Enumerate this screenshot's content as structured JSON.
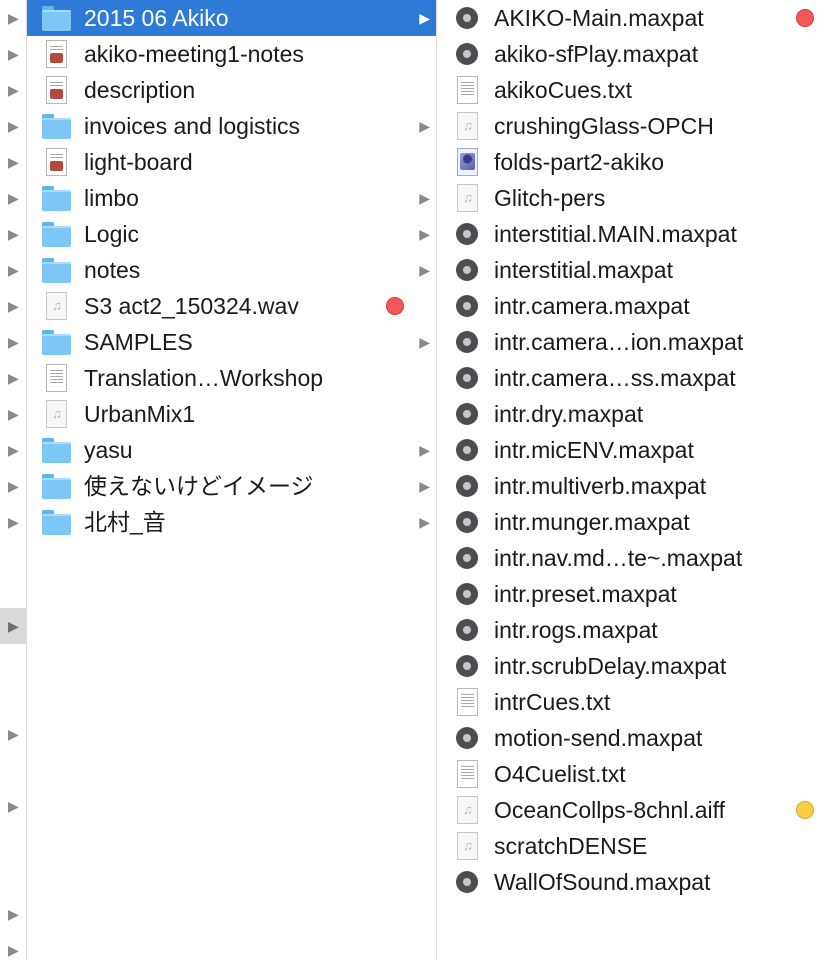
{
  "colors": {
    "selection": "#2f7ad6",
    "tag_red": "#f2585a",
    "tag_yellow": "#f7ce46"
  },
  "column1": [
    {
      "name": "2015 06 Akiko",
      "icon": "folder-icon",
      "arrow": true,
      "selected": true
    },
    {
      "name": "akiko-meeting1-notes",
      "icon": "clipping-document-icon"
    },
    {
      "name": "description",
      "icon": "clipping-document-icon"
    },
    {
      "name": "invoices and logistics",
      "icon": "folder-icon",
      "arrow": true
    },
    {
      "name": "light-board",
      "icon": "clipping-document-icon"
    },
    {
      "name": "limbo",
      "icon": "folder-icon",
      "arrow": true
    },
    {
      "name": "Logic",
      "icon": "folder-icon",
      "arrow": true
    },
    {
      "name": "notes",
      "icon": "folder-icon",
      "arrow": true
    },
    {
      "name": "S3  act2_150324.wav",
      "icon": "audio-file-icon",
      "tag": "red"
    },
    {
      "name": "SAMPLES",
      "icon": "folder-icon",
      "arrow": true
    },
    {
      "name": "Translation…Workshop",
      "icon": "text-document-icon"
    },
    {
      "name": "UrbanMix1",
      "icon": "audio-file-icon"
    },
    {
      "name": "yasu",
      "icon": "folder-icon",
      "arrow": true
    },
    {
      "name": "使えないけどイメージ",
      "icon": "folder-icon",
      "arrow": true
    },
    {
      "name": "北村_音",
      "icon": "folder-icon",
      "arrow": true
    }
  ],
  "column2": [
    {
      "name": "AKIKO-Main.maxpat",
      "icon": "max-patch-icon",
      "tag": "red"
    },
    {
      "name": "akiko-sfPlay.maxpat",
      "icon": "max-patch-icon"
    },
    {
      "name": "akikoCues.txt",
      "icon": "text-document-icon"
    },
    {
      "name": "crushingGlass-OPCH",
      "icon": "audio-file-icon"
    },
    {
      "name": "folds-part2-akiko",
      "icon": "image-file-icon"
    },
    {
      "name": "Glitch-pers",
      "icon": "audio-file-icon"
    },
    {
      "name": "interstitial.MAIN.maxpat",
      "icon": "max-patch-icon"
    },
    {
      "name": "interstitial.maxpat",
      "icon": "max-patch-icon"
    },
    {
      "name": "intr.camera.maxpat",
      "icon": "max-patch-icon"
    },
    {
      "name": "intr.camera…ion.maxpat",
      "icon": "max-patch-icon"
    },
    {
      "name": "intr.camera…ss.maxpat",
      "icon": "max-patch-icon"
    },
    {
      "name": "intr.dry.maxpat",
      "icon": "max-patch-icon"
    },
    {
      "name": "intr.micENV.maxpat",
      "icon": "max-patch-icon"
    },
    {
      "name": "intr.multiverb.maxpat",
      "icon": "max-patch-icon"
    },
    {
      "name": "intr.munger.maxpat",
      "icon": "max-patch-icon"
    },
    {
      "name": "intr.nav.md…te~.maxpat",
      "icon": "max-patch-icon"
    },
    {
      "name": "intr.preset.maxpat",
      "icon": "max-patch-icon"
    },
    {
      "name": "intr.rogs.maxpat",
      "icon": "max-patch-icon"
    },
    {
      "name": "intr.scrubDelay.maxpat",
      "icon": "max-patch-icon"
    },
    {
      "name": "intrCues.txt",
      "icon": "text-document-icon"
    },
    {
      "name": "motion-send.maxpat",
      "icon": "max-patch-icon"
    },
    {
      "name": "O4Cuelist.txt",
      "icon": "text-document-icon"
    },
    {
      "name": "OceanCollps-8chnl.aiff",
      "icon": "audio-file-icon",
      "tag": "yellow"
    },
    {
      "name": "scratchDENSE",
      "icon": "audio-file-icon"
    },
    {
      "name": "WallOfSound.maxpat",
      "icon": "max-patch-icon"
    }
  ]
}
